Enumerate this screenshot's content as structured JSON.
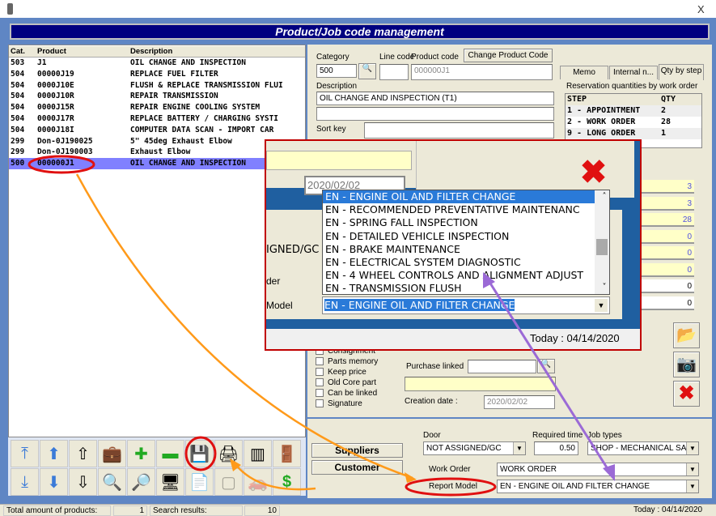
{
  "window": {
    "title": "Product/Job code management",
    "close": "X"
  },
  "list": {
    "headers": [
      "Cat.",
      "Product",
      "Description"
    ],
    "rows": [
      [
        "503",
        "J1",
        "OIL CHANGE AND INSPECTION"
      ],
      [
        "504",
        "00000J19",
        "REPLACE FUEL FILTER"
      ],
      [
        "504",
        "0000J10E",
        "FLUSH & REPLACE TRANSMISSION FLUI"
      ],
      [
        "504",
        "0000J10R",
        "REPAIR TRANSMISSION"
      ],
      [
        "504",
        "0000J15R",
        "REPAIR ENGINE COOLING SYSTEM"
      ],
      [
        "504",
        "0000J17R",
        "REPLACE  BATTERY / CHARGING SYSTI"
      ],
      [
        "504",
        "0000J18I",
        "COMPUTER DATA SCAN - IMPORT CAR"
      ],
      [
        "299",
        "Don-0J190025",
        "5\" 45deg Exhaust Elbow"
      ],
      [
        "299",
        "Don-0J190003",
        "Exhaust Elbow"
      ],
      [
        "500",
        "000000J1",
        "OIL CHANGE AND INSPECTION"
      ]
    ],
    "selected_index": 9
  },
  "toolbar": {
    "icons": [
      "first-record-icon",
      "previous-icon",
      "move-up-icon",
      "briefcase-icon",
      "add-icon",
      "remove-icon",
      "save-icon",
      "print-icon",
      "barcode-icon",
      "exit-icon",
      "last-record-icon",
      "next-icon",
      "move-down-icon",
      "search-icon",
      "view-icon",
      "computer-icon",
      "notes-icon",
      "image-disabled-icon",
      "car-disabled-icon",
      "price-icon"
    ]
  },
  "form": {
    "category_label": "Category",
    "category": "500",
    "line_code_label": "Line code",
    "line_code": "",
    "product_code_label": "Product code",
    "product_code": "000000J1",
    "change_code_button": "Change Product Code",
    "description_label": "Description",
    "description": "OIL CHANGE AND INSPECTION (T1)",
    "description2": "",
    "sort_key_label": "Sort key",
    "sort_key": ""
  },
  "tabs": [
    "Memo",
    "Internal n...",
    "Qty by step"
  ],
  "qty": {
    "group_label": "Reservation quantities by work order",
    "headers": [
      "STEP",
      "QTY"
    ],
    "rows": [
      [
        "1 - APPOINTMENT",
        "2"
      ],
      [
        "2 - WORK ORDER",
        "28"
      ],
      [
        "9 - LONG ORDER",
        "1"
      ]
    ]
  },
  "side_values": [
    "3",
    "3",
    "28",
    "0",
    "0",
    "0",
    "0",
    "0"
  ],
  "checkboxes": [
    "Consignment",
    "Parts memory",
    "Keep price",
    "Old Core part",
    "Can be linked",
    "Signature"
  ],
  "purchase_linked_label": "Purchase linked",
  "creation_date_label": "Creation date :",
  "creation_date": "2020/02/02",
  "buttons": {
    "suppliers": "Suppliers",
    "customer": "Customer"
  },
  "lower": {
    "door_label": "Door",
    "door": "NOT ASSIGNED/GC",
    "required_time_label": "Required time",
    "required_time": "0.50",
    "job_types_label": "Job types",
    "job_types": "SHOP - MECHANICAL SALE",
    "work_order_label": "Work Order",
    "work_order": "WORK ORDER",
    "report_model_label": "Report Model",
    "report_model": "EN - ENGINE OIL AND FILTER CHANGE"
  },
  "popup": {
    "date": "2020/02/02",
    "door_partial": "IGNED/GC",
    "label_partial1": "der",
    "label_partial2": "Model",
    "options": [
      "EN - ENGINE OIL AND FILTER CHANGE",
      "EN - RECOMMENDED PREVENTATIVE MAINTENANC",
      "EN - SPRING FALL INSPECTION",
      "EN - DETAILED VEHICLE INSPECTION",
      "EN - BRAKE MAINTENANCE",
      "EN - ELECTRICAL SYSTEM DIAGNOSTIC",
      "EN - 4 WHEEL CONTROLS AND ALIGNMENT ADJUST",
      "EN - TRANSMISSION FLUSH"
    ],
    "selected": "EN - ENGINE OIL AND FILTER CHANGE",
    "today": "Today : 04/14/2020"
  },
  "status": {
    "total_label": "Total amount of products:",
    "total": "1",
    "search_label": "Search results:",
    "search": "10",
    "today": "Today : 04/14/2020"
  },
  "annotation_colors": {
    "orange": "#ff9a1a",
    "purple": "#9b6ad6",
    "red": "#e01010"
  }
}
